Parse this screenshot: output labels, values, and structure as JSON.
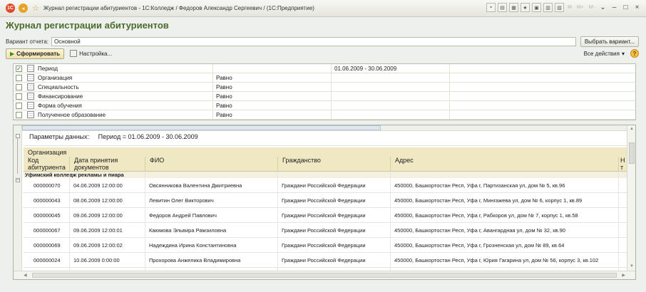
{
  "window": {
    "title": "Журнал регистрации абитуриентов - 1С:Колледж / Федоров Александр Сергеевич / (1С:Предприятие)",
    "memory_buttons": [
      "M",
      "M+",
      "M-"
    ]
  },
  "page": {
    "title": "Журнал регистрации абитуриентов"
  },
  "variant": {
    "label": "Вариант отчета:",
    "value": "Основной",
    "select_button": "Выбрать вариант..."
  },
  "toolbar": {
    "generate": "Сформировать",
    "settings": "Настройка...",
    "all_actions": "Все действия",
    "help": "?"
  },
  "filters": [
    {
      "checked": true,
      "name": "Период",
      "op": "",
      "value": "01.06.2009 - 30.06.2009"
    },
    {
      "checked": false,
      "name": "Организация",
      "op": "Равно",
      "value": ""
    },
    {
      "checked": false,
      "name": "Специальность",
      "op": "Равно",
      "value": ""
    },
    {
      "checked": false,
      "name": "Финансирование",
      "op": "Равно",
      "value": ""
    },
    {
      "checked": false,
      "name": "Форма обучения",
      "op": "Равно",
      "value": ""
    },
    {
      "checked": false,
      "name": "Полученное образование",
      "op": "Равно",
      "value": ""
    }
  ],
  "report": {
    "params_label": "Параметры данных:",
    "params_value": "Период = 01.06.2009 - 30.06.2009",
    "group_header": "Организация",
    "columns": [
      "Код абитуриента",
      "Дата принятия документов",
      "ФИО",
      "Гражданство",
      "Адрес",
      "Н т"
    ],
    "col_code_1": "Код",
    "col_code_2": "абитуриента",
    "col_date_1": "Дата принятия",
    "col_date_2": "документов",
    "col_extra_1": "Н",
    "col_extra_2": "т",
    "group_name": "Уфимский колледж рекламы и пиара",
    "rows": [
      {
        "code": "000000070",
        "date": "04.06.2009 12:00:00",
        "fio": "Овсянникова Валентина Дмитриевна",
        "citizenship": "Граждани Российской Федерации",
        "address": "450000, Башкортостан Респ, Уфа г, Партизанская ул, дом № 5, кв.96"
      },
      {
        "code": "000000043",
        "date": "08.06.2009 12:00:00",
        "fio": "Левитин Олег Викторович",
        "citizenship": "Граждани Российской Федерации",
        "address": "450000, Башкортостан Респ, Уфа г, Мингажева ул, дом № 6, корпус 1, кв.89"
      },
      {
        "code": "000000045",
        "date": "09.06.2009 12:00:00",
        "fio": "Федоров Андрей Павлович",
        "citizenship": "Граждани Российской Федерации",
        "address": "450000, Башкортостан Респ, Уфа г, Рабкоров ул, дом № 7, корпус 1, кв.58"
      },
      {
        "code": "000000067",
        "date": "09.06.2009 12:00:01",
        "fio": "Каюмова Эльвира Рамзиловна",
        "citizenship": "Граждани Российской Федерации",
        "address": "450000, Башкортостан Респ, Уфа г, Авангардная ул, дом № 32, кв.90"
      },
      {
        "code": "000000069",
        "date": "09.06.2009 12:00:02",
        "fio": "Надеждина Ирина Константиновна",
        "citizenship": "Граждани Российской Федерации",
        "address": "450000, Башкортостан Респ, Уфа г, Грозненская ул, дом № 89, кв.64"
      },
      {
        "code": "000000024",
        "date": "10.06.2009 0:00:00",
        "fio": "Прохорова Анжелика Владимировна",
        "citizenship": "Граждани Российской Федерации",
        "address": "450000, Башкортостан Респ, Уфа г, Юрия Гагарина ул, дом № 56, корпус 3, кв.102"
      }
    ]
  }
}
